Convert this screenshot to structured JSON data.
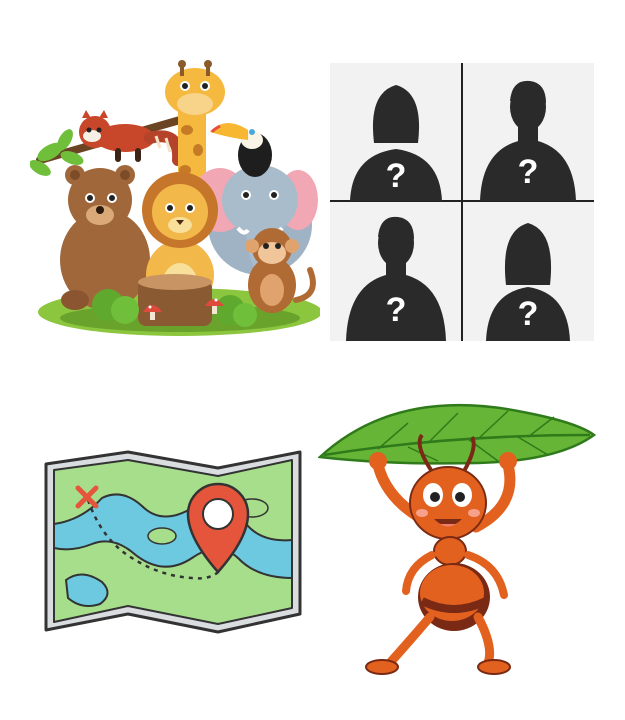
{
  "colors": {
    "background": "#ffffff",
    "silhouette": "#2a2a2a",
    "silhouette_panel": "#f2f2f2",
    "grid_line": "#222222",
    "map_land": "#a7de8c",
    "map_water": "#6cc9e0",
    "map_pin": "#e5553b",
    "map_cross": "#e5553b",
    "ant_body": "#e2611f",
    "ant_dark": "#7a2a14",
    "leaf": "#67b536",
    "leaf_dark": "#2f7a1a"
  },
  "images": [
    {
      "name": "cartoon-animals-group",
      "subjects": [
        "red-panda",
        "giraffe",
        "toucan",
        "bear",
        "lion",
        "elephant",
        "monkey"
      ]
    },
    {
      "name": "mystery-silhouettes-grid",
      "panels": 4,
      "symbol": "?"
    },
    {
      "name": "treasure-map-illustration",
      "marks": [
        "cross",
        "location-pin",
        "dashed-path"
      ]
    },
    {
      "name": "cartoon-ant-holding-leaf"
    }
  ]
}
